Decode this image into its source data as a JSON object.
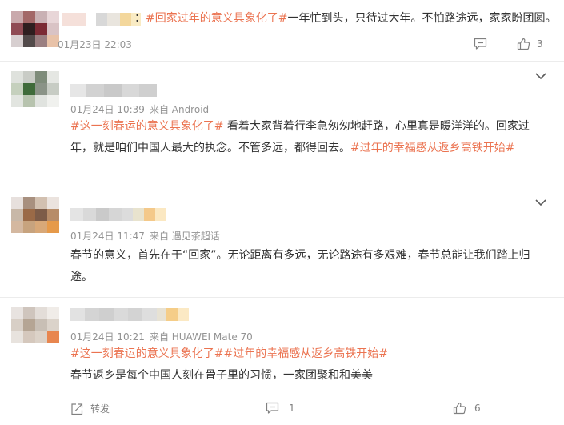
{
  "posts": [
    {
      "separator": "：",
      "hashtags": [
        "#回家过年的意义具象化了#"
      ],
      "text": "一年忙到头，只待过大年。不怕路途远，家家盼团圆。",
      "time": "01月23日 22:03",
      "likes": "3"
    },
    {
      "time": "01月24日 10:39",
      "source": "来自 Android",
      "hashtag_lead": "#这一刻春运的意义具象化了#",
      "text": " 看着大家背着行李急匆匆地赶路，心里真是暖洋洋的。回家过年，就是咱们中国人最大的执念。不管多远，都得回去。",
      "hashtag_tail": "#过年的幸福感从返乡高铁开始#"
    },
    {
      "time": "01月24日 11:47",
      "source": "来自 遇见茶超话",
      "text": "春节的意义，首先在于“回家”。无论距离有多远，无论路途有多艰难，春节总能让我们踏上归途。"
    },
    {
      "time": "01月24日 10:21",
      "source": "来自 HUAWEI Mate 70",
      "hashtags": [
        "#这一刻春运的意义具象化了#",
        "#过年的幸福感从返乡高铁开始#"
      ],
      "text": "春节返乡是每个中国人刻在骨子里的习惯，一家团聚和和美美",
      "repost_label": "转发",
      "comments": "1",
      "likes": "6"
    }
  ],
  "colors": {
    "hashtag": "#eb7350",
    "text": "#333333",
    "meta": "#939393"
  },
  "icons": [
    "comment-icon",
    "like-icon",
    "chevron-down-icon",
    "repost-icon"
  ]
}
